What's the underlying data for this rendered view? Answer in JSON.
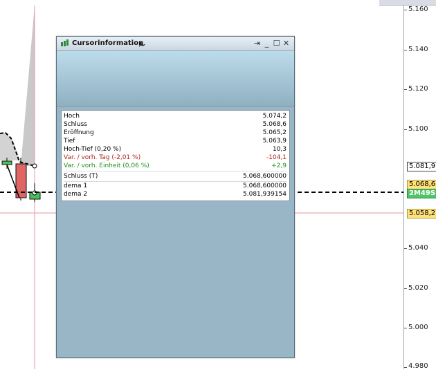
{
  "axis": {
    "labels": [
      "5.160",
      "5.140",
      "5.120",
      "5.100",
      "5.081,9",
      "5.068,6",
      "2M49S",
      "5.058,2",
      "5.040",
      "5.020",
      "5.000",
      "4.980"
    ]
  },
  "window": {
    "title": "Cursorinformation",
    "rows": [
      {
        "label": "Hoch",
        "value": "5.074,2",
        "color": "#111111"
      },
      {
        "label": "Schluss",
        "value": "5.068,6",
        "color": "#111111"
      },
      {
        "label": "Eröffnung",
        "value": "5.065,2",
        "color": "#111111"
      },
      {
        "label": "Tief",
        "value": "5.063,9",
        "color": "#111111"
      },
      {
        "label": "Hoch-Tief (0,20 %)",
        "value": "10,3",
        "color": "#111111"
      },
      {
        "label": "Var. / vorh. Tag (-2,01 %)",
        "value": "-104,1",
        "color": "#b3201c"
      },
      {
        "label": "Var. / vorh. Einheit (0,06 %)",
        "value": "+2,9",
        "color": "#1f8f1f"
      },
      {
        "label": "Schluss (T)",
        "value": "5.068,600000",
        "color": "#111111"
      },
      {
        "label": "dema 1",
        "value": "5.068,600000",
        "color": "#111111"
      },
      {
        "label": "dema 2",
        "value": "5.081,939154",
        "color": "#111111"
      }
    ]
  }
}
